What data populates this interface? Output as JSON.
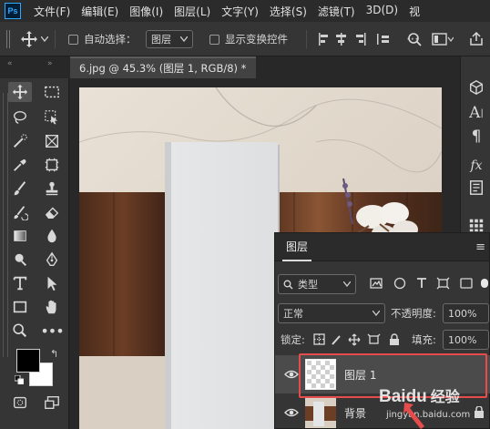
{
  "app": {
    "logo_text": "Ps"
  },
  "menu": [
    "文件(F)",
    "编辑(E)",
    "图像(I)",
    "图层(L)",
    "文字(Y)",
    "选择(S)",
    "滤镜(T)",
    "3D(D)",
    "视"
  ],
  "options_bar": {
    "auto_select_label": "自动选择：",
    "auto_select_value": "图层",
    "show_transform_label": "显示变换控件"
  },
  "document_tab": {
    "title": "6.jpg @ 45.3% (图层 1, RGB/8) *"
  },
  "layers_panel": {
    "title": "图层",
    "kind_filter": "类型",
    "blend_mode": "正常",
    "opacity_label": "不透明度:",
    "opacity_value": "100%",
    "lock_label": "锁定:",
    "fill_label": "填充:",
    "fill_value": "100%",
    "layers": [
      {
        "name": "图层 1",
        "selected": true
      },
      {
        "name": "背景",
        "selected": false
      }
    ]
  },
  "colors": {
    "foreground": "#000000",
    "background": "#ffffff",
    "highlight_border": "#e74c4c"
  },
  "watermark": {
    "brand": "Baidu",
    "sub": "经验",
    "url": "jingyan.baidu.com"
  },
  "icons": [
    "move-icon",
    "marquee-icon",
    "lasso-icon",
    "crop-icon",
    "eyedropper-icon",
    "brush-icon",
    "stamp-icon",
    "eraser-icon",
    "gradient-icon",
    "pen-icon",
    "type-icon",
    "path-select-icon",
    "rectangle-icon",
    "hand-icon",
    "zoom-icon",
    "more-icon",
    "3d-icon",
    "character-icon",
    "paragraph-icon",
    "fx-icon",
    "eye-icon",
    "lock-icon"
  ]
}
